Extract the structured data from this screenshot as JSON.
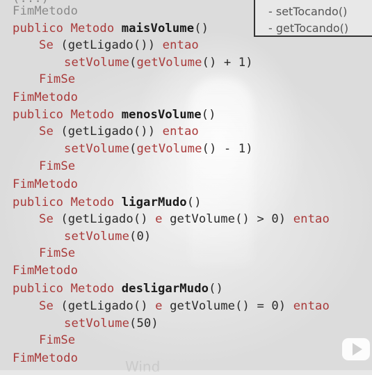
{
  "legend": {
    "items": [
      "- setTocando()",
      "- getTocando()"
    ]
  },
  "watermark": "Wind",
  "code": {
    "ellipsis": "(...)",
    "l1": {
      "a": "FimMetodo"
    },
    "l2": {
      "kw": "publico Metodo ",
      "name": "maisVolume",
      "rest": "()"
    },
    "l3": {
      "se": "Se ",
      "cond": "(getLigado()) ",
      "entao": "entao"
    },
    "l4": {
      "call": "setVolume(getVolume() + 1)"
    },
    "l5": {
      "a": "FimSe"
    },
    "l6": {
      "a": "FimMetodo"
    },
    "l7": {
      "kw": "publico Metodo ",
      "name": "menosVolume",
      "rest": "()"
    },
    "l8": {
      "se": "Se ",
      "cond": "(getLigado()) ",
      "entao": "entao"
    },
    "l9": {
      "call": "setVolume(getVolume() - 1)"
    },
    "l10": {
      "a": "FimSe"
    },
    "l11": {
      "a": "FimMetodo"
    },
    "l12": {
      "kw": "publico Metodo ",
      "name": "ligarMudo",
      "rest": "()"
    },
    "l13": {
      "se": "Se ",
      "cond": "(getLigado() ",
      "e": "e",
      "cond2": " getVolume() > 0) ",
      "entao": "entao"
    },
    "l14": {
      "call": "setVolume(0)"
    },
    "l15": {
      "a": "FimSe"
    },
    "l16": {
      "a": "FimMetodo"
    },
    "l17": {
      "kw": "publico Metodo ",
      "name": "desligarMudo",
      "rest": "()"
    },
    "l18": {
      "se": "Se ",
      "cond": "(getLigado() ",
      "e": "e",
      "cond2": " getVolume() = 0) ",
      "entao": "entao"
    },
    "l19": {
      "call": "setVolume(50)"
    },
    "l20": {
      "a": "FimSe"
    },
    "l21": {
      "a": "FimMetodo"
    }
  },
  "icons": {
    "play": "play-icon"
  },
  "colors": {
    "keyword": "#a93a3a",
    "text": "#2a2a2a"
  }
}
